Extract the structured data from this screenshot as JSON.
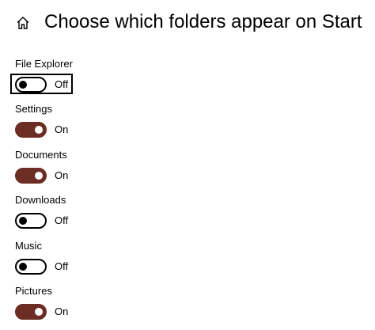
{
  "header": {
    "title": "Choose which folders appear on Start",
    "home_icon": "home-icon"
  },
  "colors": {
    "toggle_on": "#6b2d24",
    "toggle_off_border": "#000000",
    "text": "#000000",
    "background": "#ffffff"
  },
  "settings": [
    {
      "label": "File Explorer",
      "state": "Off",
      "on": false,
      "focused": true
    },
    {
      "label": "Settings",
      "state": "On",
      "on": true,
      "focused": false
    },
    {
      "label": "Documents",
      "state": "On",
      "on": true,
      "focused": false
    },
    {
      "label": "Downloads",
      "state": "Off",
      "on": false,
      "focused": false
    },
    {
      "label": "Music",
      "state": "Off",
      "on": false,
      "focused": false
    },
    {
      "label": "Pictures",
      "state": "On",
      "on": true,
      "focused": false
    }
  ]
}
